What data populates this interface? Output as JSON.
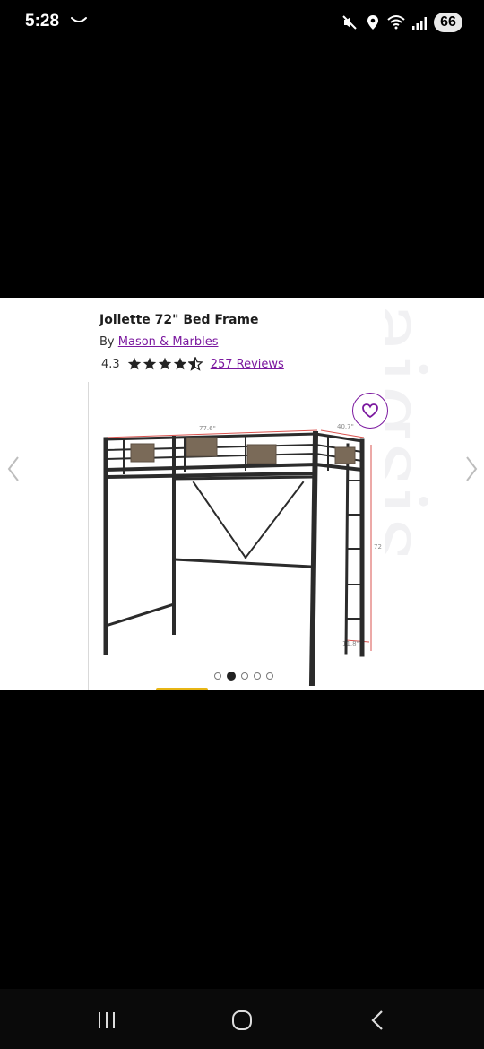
{
  "status_bar": {
    "time": "5:28",
    "battery": "66",
    "icons": [
      "cast-icon",
      "mute-icon",
      "location-icon",
      "wifi-icon",
      "signal-icon"
    ]
  },
  "product": {
    "title": "Joliette 72\" Bed Frame",
    "by_prefix": "By",
    "brand": "Mason & Marbles",
    "rating": "4.3",
    "stars_filled": 4,
    "stars_half": 1,
    "reviews": "257 Reviews",
    "dims": {
      "length": "77.6\"",
      "width": "40.7\"",
      "height": "72\"",
      "rung": "11.8\""
    },
    "image_count": 5,
    "active_image": 2
  },
  "watermark_text": "aigsis",
  "colors": {
    "accent": "#7b189f",
    "highlight": "#e7b515"
  }
}
